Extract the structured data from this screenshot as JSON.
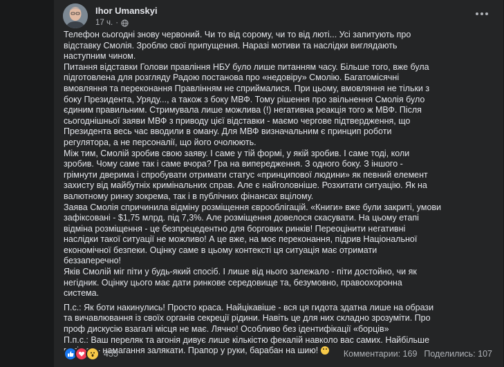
{
  "post": {
    "author": "Ihor Umanskyi",
    "time": "17 ч.",
    "paragraphs": [
      "Телефон сьогодні знову червоний. Чи то від сорому, чи то від люті... Усі запитують про\nвідставку Смолія. Зроблю свої припущення. Наразі мотиви та наслідки виглядають\nнаступним чином.",
      "Питання відставки Голови правління НБУ було лише питанням часу. Більше того, вже була\nпідготовлена для розгляду Радою постанова про «недовіру» Смолію. Багатомісячні\nвмовляння та переконання Правлінням не сприймалися. При цьому, вмовляння не тільки з\nбоку Президента, Уряду..., а також з боку МВФ. Тому рішення про звільнення Смолія було\nєдиним правильним. Стримувала лише можлива (!) негативна реакція того ж МВФ. Після\nсьогоднішньої заяви МВФ з приводу цієї відставки - маємо чергове підтвердження, що\nПрезидента весь час вводили в оману. Для МВФ визначальним є принцип роботи\nрегулятора, а не персоналії, що його очолюють.",
      "Між тим, Смолій зробив свою заяву. І саме у тій формі, у якій зробив. І саме тоді, коли\nзробив. Чому саме так і саме вчора? Гра на випередження. З одного боку. З іншого -\nгрімнути дверима і спробувати отримати статус «принципової людини» як певний елемент\nзахисту від майбутніх кримінальних справ. Але є найголовніше. Розхитати ситуацію. Як на\nвалютному ринку зокрема, так і в публічних фінансах вцілому.",
      "Заява Смолія спричинила відміну розміщення єврооблігацій. «Книги» вже були закриті, умови\nзафіксовані - $1,75 млрд. під 7,3%. Але розміщення довелося скасувати. На цьому етапі\nвідміна розміщення - це безпрецедентно для боргових ринків! Переоцінити негативні\nнаслідки такої ситуації не можливо! А це вже, на моє переконання, підрив Національної\nекономічної безпеки. Оцінку саме в цьому контексті ця ситуація має отримати\nбеззаперечно!",
      "Яків Смолій міг піти у будь-який спосіб. І лише від нього залежало - піти достойно, чи як\nнегідник. Оцінку цього має дати ринкове середовище та, безумовно, правоохоронна\nсистема.",
      "П.с.: Як боти накинулись! Просто краса. Найцікавіше - вся ця гидота здатна лише на образи\nта вичавлювання із своїх органів секреції рідини. Навіть це для них складно зрозуміти. Про\nпроф дискусію взагалі місця не має. Лячно! Особливо без ідентифікації «борців»",
      "П.п.с.: Ваш переляк та агонія дивує лише кількістю фекалій навколо вас самих. Найбільше\nпотішає - намагання залякати. Прапор у руки, барабан на шию!"
    ]
  },
  "footer": {
    "reaction_count": "455",
    "comments": "Комментарии: 169",
    "shares": "Поделились: 107"
  },
  "colors": {
    "background": "#18191a",
    "card": "#242526",
    "text": "#e4e6eb",
    "secondary": "#b0b3b8",
    "like_blue": "#1877f2",
    "love_red": "#f33e58",
    "wow_yellow": "#f7c948"
  },
  "icons": {
    "avatar": "author-avatar",
    "globe": "globe-icon",
    "more": "more-options-icon",
    "reactions": [
      "like-icon",
      "love-icon",
      "wow-icon"
    ]
  }
}
